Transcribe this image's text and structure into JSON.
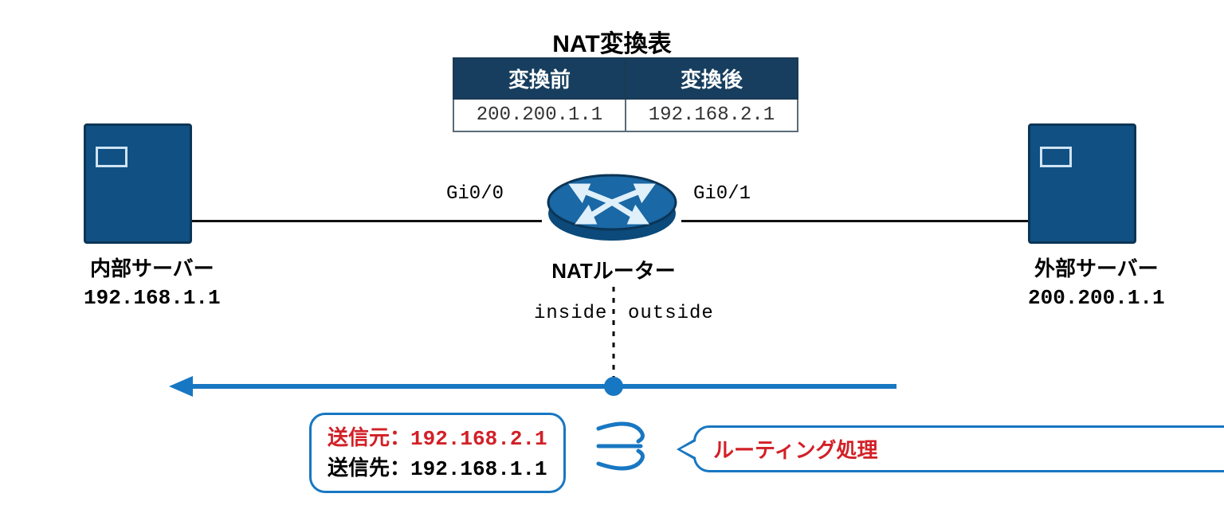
{
  "colors": {
    "brand_blue": "#105083",
    "accent_blue": "#1877c2",
    "table_header": "#173e5e",
    "red": "#d22027"
  },
  "nat_table": {
    "title": "NAT変換表",
    "header_before": "変換前",
    "header_after": "変換後",
    "row_before": "200.200.1.1",
    "row_after": "192.168.2.1"
  },
  "internal_server": {
    "label": "内部サーバー",
    "ip": "192.168.1.1"
  },
  "external_server": {
    "label": "外部サーバー",
    "ip": "200.200.1.1"
  },
  "router": {
    "label": "NATルーター",
    "iface_left": "Gi0/0",
    "iface_right": "Gi0/1",
    "zone_inside": "inside",
    "zone_outside": "outside"
  },
  "packet": {
    "src_label": "送信元：",
    "dst_label": "送信先：",
    "src_ip": "192.168.2.1",
    "dst_ip": "192.168.1.1"
  },
  "callout": {
    "text": "ルーティング処理"
  }
}
